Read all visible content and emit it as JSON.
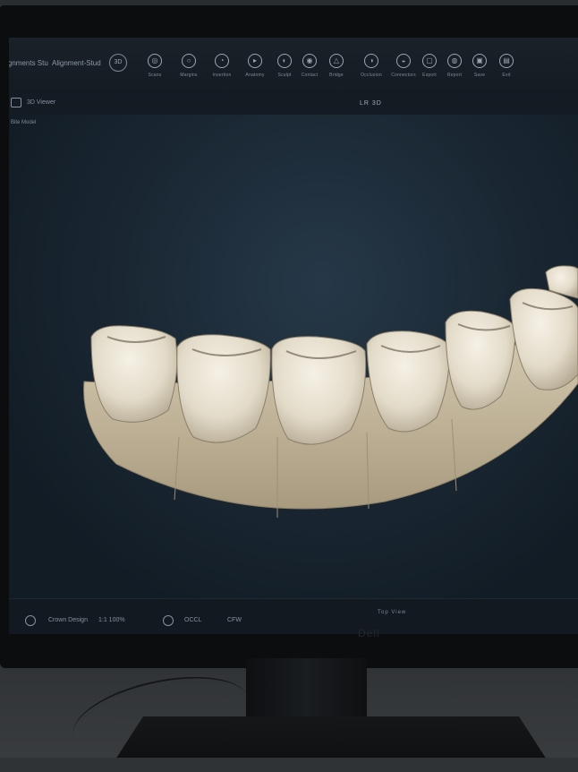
{
  "toolbar": {
    "brand_left": "Alignments Stu",
    "brand_right": "Alignment-Stud",
    "brand_icon": "3D",
    "tools": [
      {
        "label": "Scans",
        "icon": "scan-icon"
      },
      {
        "label": "Margins",
        "icon": "margin-icon"
      },
      {
        "label": "Insertion",
        "icon": "insertion-icon"
      },
      {
        "label": "Anatomy",
        "icon": "anatomy-icon"
      },
      {
        "label": "Sculpt",
        "icon": "sculpt-icon"
      },
      {
        "label": "Contact",
        "icon": "contact-icon"
      },
      {
        "label": "Bridge",
        "icon": "bridge-icon"
      },
      {
        "label": "Occlusion",
        "icon": "occlusion-icon"
      },
      {
        "label": "Connectors",
        "icon": "connectors-icon"
      },
      {
        "label": "Export",
        "icon": "export-icon"
      },
      {
        "label": "Report",
        "icon": "report-icon"
      },
      {
        "label": "Save",
        "icon": "save-icon"
      },
      {
        "label": "Exit",
        "icon": "exit-icon"
      }
    ]
  },
  "subbar": {
    "title": "3D Viewer",
    "center": "LR 3D"
  },
  "panel": {
    "label": "Bite Model"
  },
  "statusbar": {
    "left_text": "Crown Design",
    "zoom": "1:1 100%",
    "view": "OCCL",
    "mode": "CFW",
    "mid": "Top View"
  },
  "bezel": {
    "logo": "Dell"
  }
}
